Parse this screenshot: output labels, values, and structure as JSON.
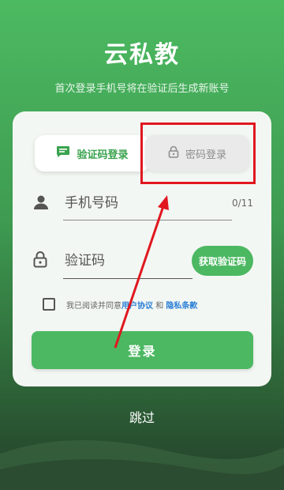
{
  "header": {
    "title": "云私教",
    "subtitle": "首次登录手机号将在验证后生成新账号"
  },
  "tabs": {
    "sms": {
      "label": "验证码登录",
      "icon": "message-icon",
      "selected": true
    },
    "password": {
      "label": "密码登录",
      "icon": "lock-icon",
      "selected": false
    }
  },
  "phone": {
    "placeholder": "手机号码",
    "value": "",
    "counter": "0/11",
    "icon": "person-icon"
  },
  "code": {
    "placeholder": "验证码",
    "value": "",
    "icon": "lock-icon",
    "get_code_label": "获取验证码"
  },
  "agreement": {
    "prefix": "我已阅读并同意",
    "link1": "用户协议",
    "conjunction": "和",
    "link2": "隐私条款",
    "checked": false
  },
  "login_label": "登录",
  "skip_label": "跳过",
  "colors": {
    "accent": "#4cb862",
    "link": "#2b7fd6",
    "annotation": "#e0171f"
  }
}
